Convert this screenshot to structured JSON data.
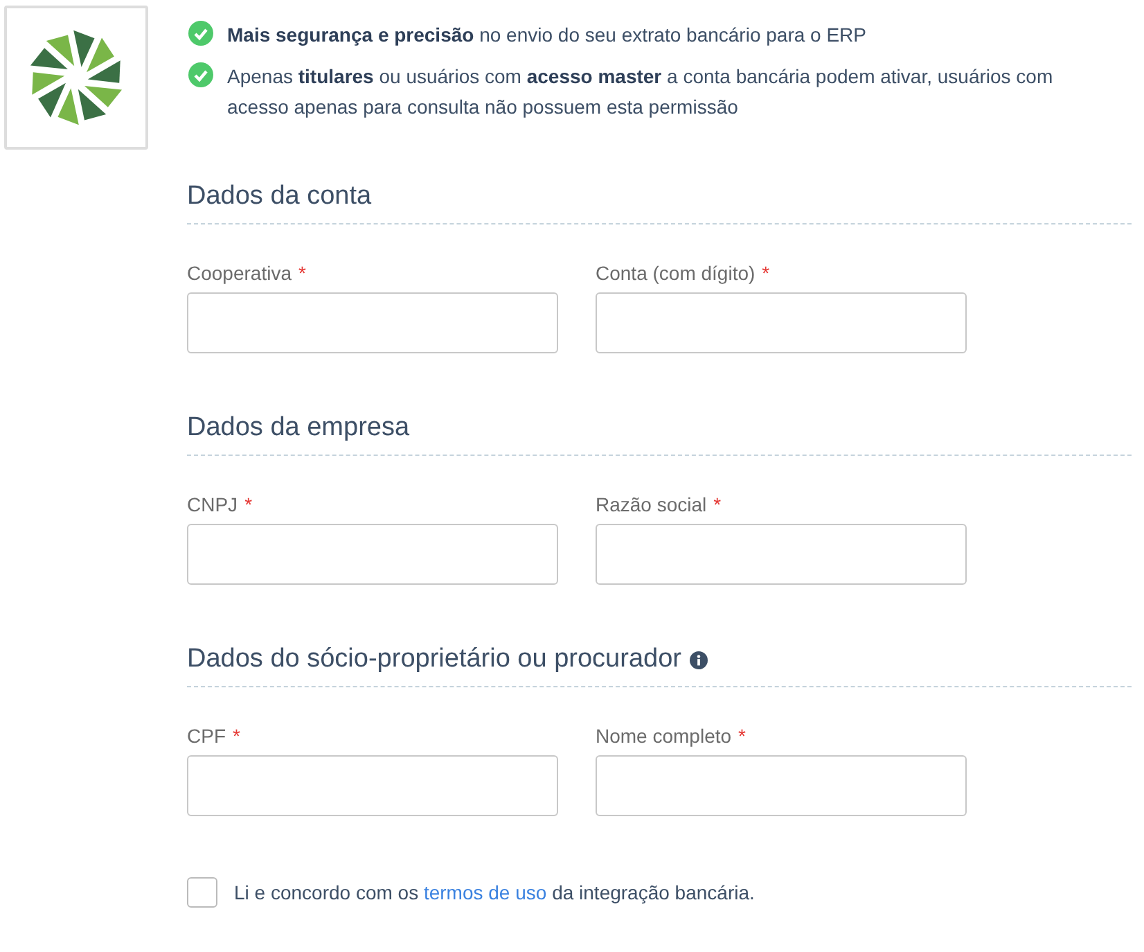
{
  "benefits": [
    {
      "text": "**Mais segurança e precisão** no envio do seu extrato bancário para o ERP"
    },
    {
      "text": "Apenas **titulares** ou usuários com **acesso master** a conta bancária podem ativar, usuários com acesso apenas para consulta não possuem esta permissão"
    }
  ],
  "sections": [
    {
      "title": "Dados da conta",
      "has_info": false,
      "fields": [
        {
          "label": "Cooperativa",
          "marker": "*"
        },
        {
          "label": "Conta (com dígito)",
          "marker": "*"
        }
      ]
    },
    {
      "title": "Dados da empresa",
      "has_info": false,
      "fields": [
        {
          "label": "CNPJ",
          "marker": "*"
        },
        {
          "label": "Razão social",
          "marker": "*"
        }
      ]
    },
    {
      "title": "Dados do sócio-proprietário ou procurador",
      "has_info": true,
      "fields": [
        {
          "label": "CPF",
          "marker": "*"
        },
        {
          "label": "Nome completo",
          "marker": "*"
        }
      ]
    }
  ],
  "agreement": {
    "checked": false,
    "before": "Li e concordo com os",
    "link": "termos de uso",
    "after": "da integração bancária."
  }
}
